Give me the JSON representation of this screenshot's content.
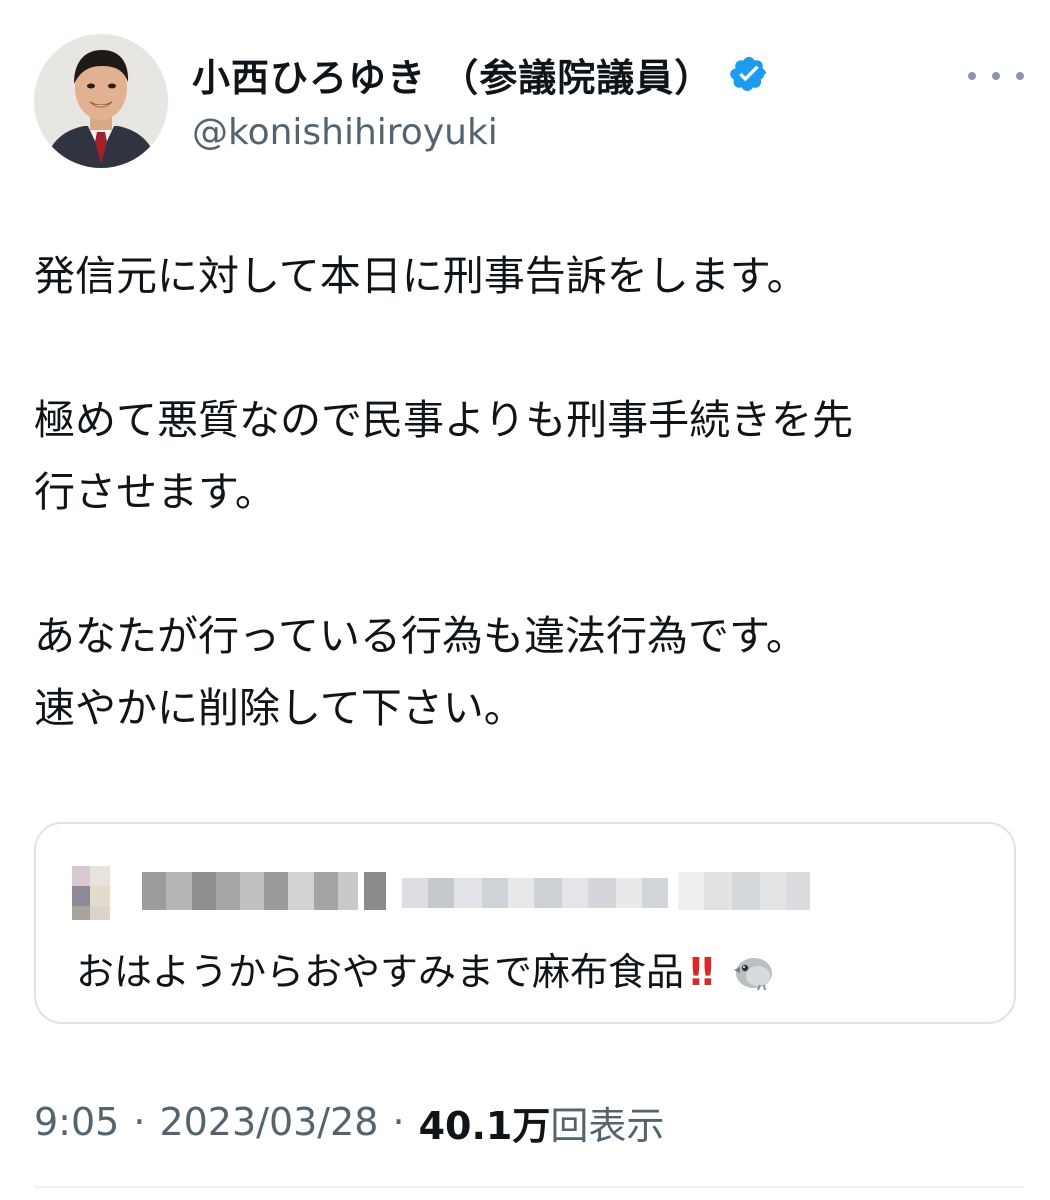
{
  "author": {
    "display_name": "小西ひろゆき （参議院議員）",
    "handle": "@konishihiroyuki",
    "verified": true
  },
  "icons": {
    "verified": "verified-badge-icon",
    "more": "more-options-icon",
    "quote_emoji": "bird-icon"
  },
  "tweet": {
    "paragraphs": [
      {
        "lines": [
          "発信元に対して本日に刑事告訴をします。"
        ]
      },
      {
        "lines": [
          "極めて悪質なので民事よりも刑事手続きを先",
          "行させます。"
        ]
      },
      {
        "lines": [
          "あなたが行っている行為も違法行為です。",
          "速やかに削除して下さい。"
        ]
      }
    ]
  },
  "quoted_tweet": {
    "text": "おはようからおやすみまで麻布食品",
    "emoji": "‼"
  },
  "meta": {
    "time": "9:05",
    "separator": "·",
    "date": "2023/03/28",
    "views_count": "40.1万",
    "views_label": "回表示"
  },
  "colors": {
    "verified_blue": "#1d9bf0",
    "secondary_text": "#536471",
    "primary_text": "#0f1419",
    "card_border": "#dfe3e6"
  }
}
